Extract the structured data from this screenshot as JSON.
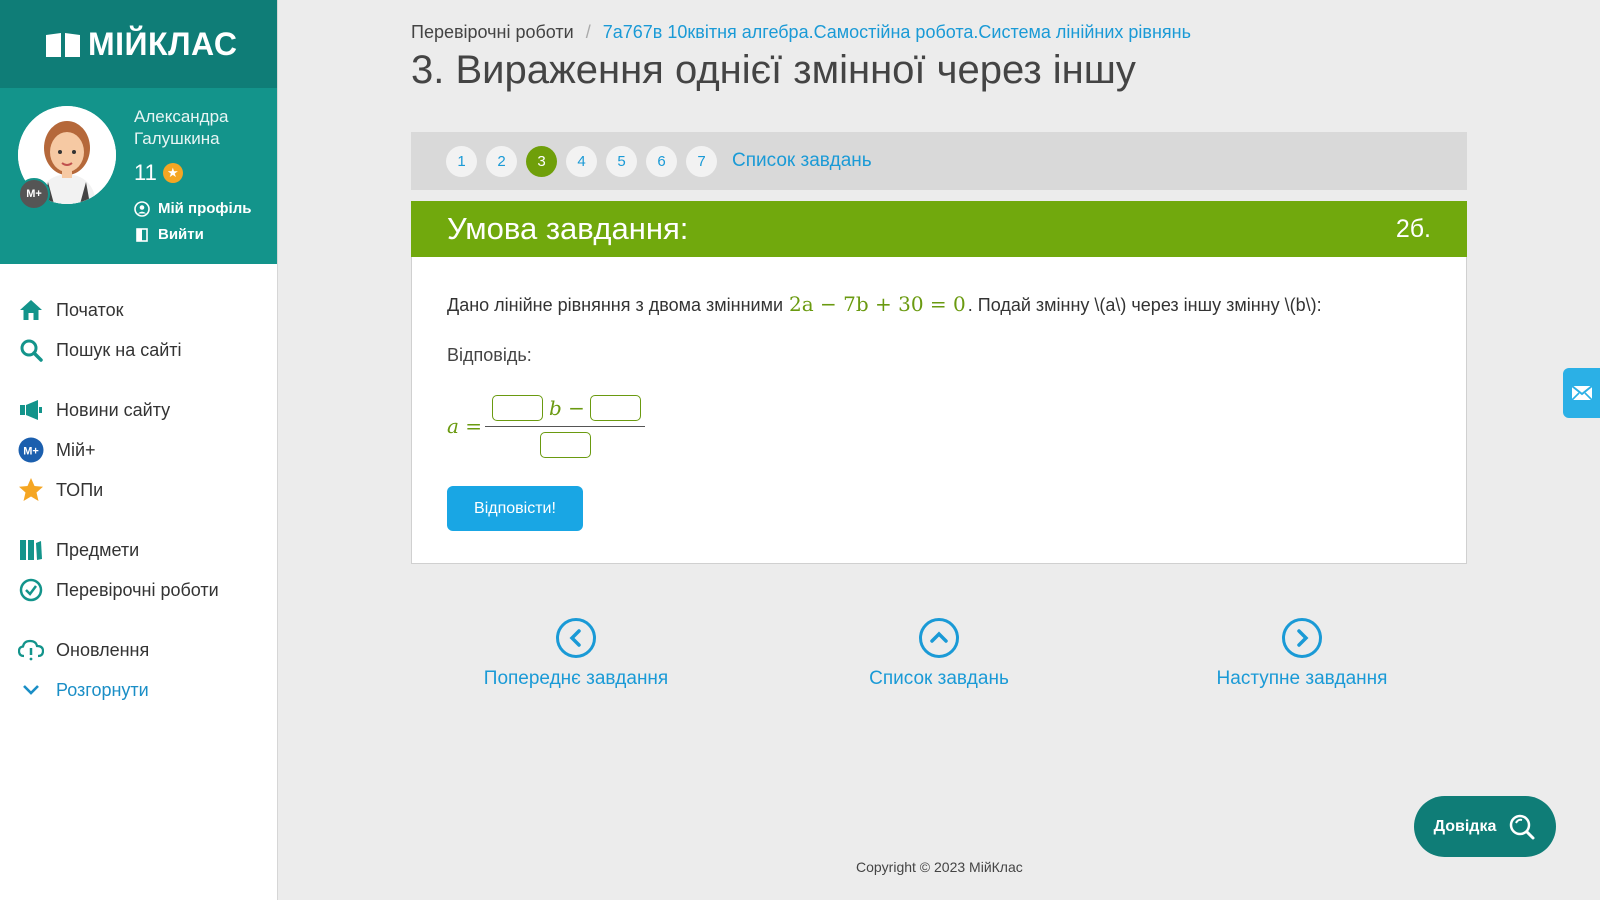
{
  "brand": {
    "logo_text": "МІЙКЛАС"
  },
  "user": {
    "name": "Александра Галушкина",
    "points": "11",
    "badge_text": "М+",
    "profile_label": "Мій профіль",
    "logout_label": "Вийти"
  },
  "nav": {
    "items": [
      {
        "label": "Початок",
        "icon": "home-icon"
      },
      {
        "label": "Пошук на сайті",
        "icon": "search-icon"
      },
      {
        "label": "Новини сайту",
        "icon": "megaphone-icon"
      },
      {
        "label": "Мій+",
        "icon": "myplus-icon"
      },
      {
        "label": "ТОПи",
        "icon": "star-icon"
      },
      {
        "label": "Предмети",
        "icon": "books-icon"
      },
      {
        "label": "Перевірочні роботи",
        "icon": "check-circle-icon"
      },
      {
        "label": "Оновлення",
        "icon": "cloud-alert-icon"
      },
      {
        "label": "Розгорнути",
        "icon": "chevron-down-icon"
      }
    ]
  },
  "breadcrumb": {
    "root": "Перевірочні роботи",
    "separator": "/",
    "current": "7а767в 10квітня алгебра.Самостійна робота.Система лінійних рівнянь"
  },
  "page_title": "3. Вираження однієї змінної через іншу",
  "task_nav": {
    "numbers": [
      "1",
      "2",
      "3",
      "4",
      "5",
      "6",
      "7"
    ],
    "active": "3",
    "list_label": "Список завдань"
  },
  "task": {
    "header": "Умова завдання:",
    "points": "2б.",
    "question_prefix": "Дано лінійне рівняння з двома змінними",
    "equation": "2a − 7b + 30 = 0",
    "question_suffix": ". Подай змінну \\(a\\) через іншу змінну \\(b\\):",
    "answer_label": "Відповідь:",
    "formula_lhs": "a =",
    "formula_var": "b −",
    "submit_label": "Відповісти!"
  },
  "bottom_nav": {
    "prev_label": "Попереднє завдання",
    "list_label": "Список завдань",
    "next_label": "Наступне завдання"
  },
  "help": {
    "label": "Довідка"
  },
  "footer": {
    "copyright": "Copyright © 2023 МійКлас"
  },
  "colors": {
    "teal_dark": "#0f7d77",
    "teal": "#13948b",
    "green": "#71a90d",
    "link_blue": "#1a9ad6",
    "button_blue": "#19a6e4"
  }
}
